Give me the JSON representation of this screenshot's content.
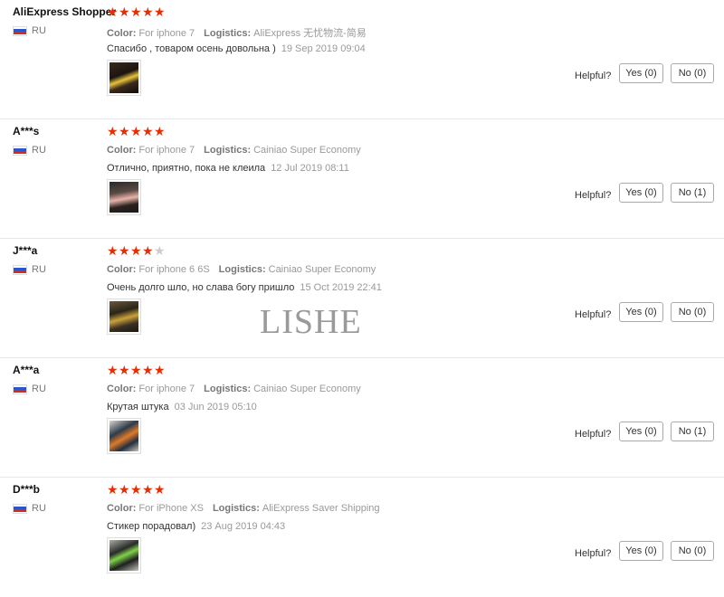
{
  "labels": {
    "color": "Color:",
    "logistics": "Logistics:",
    "helpful": "Helpful?"
  },
  "colors": {
    "star_on": "#e62e04",
    "star_off": "#cccccc"
  },
  "watermark": "LISHE",
  "reviews": [
    {
      "user": "AliExpress Shopper",
      "country": "RU",
      "rating": 5,
      "color_value": "For iphone 7",
      "logistics_value": "AliExpress 无忧物流-简易",
      "text": "Спасибо , товаром осень довольна )",
      "date": "19 Sep 2019 09:04",
      "yes": "Yes (0)",
      "no": "No (0)"
    },
    {
      "user": "A***s",
      "country": "RU",
      "rating": 5,
      "color_value": "For iphone 7",
      "logistics_value": "Cainiao Super Economy",
      "text": "Отлично, приятно, пока не клеила",
      "date": "12 Jul 2019 08:11",
      "yes": "Yes (0)",
      "no": "No (1)"
    },
    {
      "user": "J***a",
      "country": "RU",
      "rating": 4,
      "color_value": "For iphone 6 6S",
      "logistics_value": "Cainiao Super Economy",
      "text": "Очень долго шло, но слава богу пришло",
      "date": "15 Oct 2019 22:41",
      "yes": "Yes (0)",
      "no": "No (0)"
    },
    {
      "user": "A***a",
      "country": "RU",
      "rating": 5,
      "color_value": "For iphone 7",
      "logistics_value": "Cainiao Super Economy",
      "text": "Крутая штука",
      "date": "03 Jun 2019 05:10",
      "yes": "Yes (0)",
      "no": "No (1)"
    },
    {
      "user": "D***b",
      "country": "RU",
      "rating": 5,
      "color_value": "For iPhone XS",
      "logistics_value": "AliExpress Saver Shipping",
      "text": "Стикер порадовал)",
      "date": "23 Aug 2019 04:43",
      "yes": "Yes (0)",
      "no": "No (0)"
    }
  ]
}
